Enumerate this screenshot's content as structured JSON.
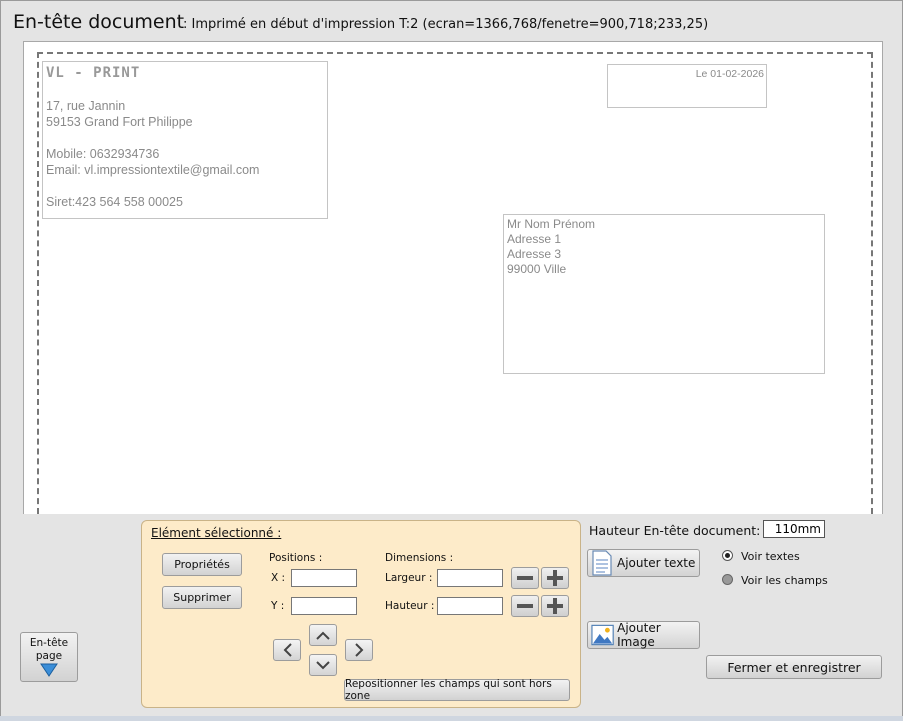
{
  "window": {
    "title": "En-tête document",
    "subtitle": ": Imprimé en début d'impression T:2 (ecran=1366,768/fenetre=900,718;233,25)"
  },
  "document": {
    "company": {
      "name": "VL - PRINT",
      "address1": "17, rue Jannin",
      "address2": "59153 Grand Fort Philippe",
      "mobile": "Mobile: 0632934736",
      "email": "Email: vl.impressiontextile@gmail.com",
      "siret": "Siret:423 564 558 00025"
    },
    "date": "Le 01-02-2026",
    "recipient": [
      "Mr Nom Prénom",
      "Adresse 1",
      "Adresse 3",
      "99000 Ville"
    ]
  },
  "panel": {
    "title": "Elément sélectionné :",
    "properties_label": "Propriétés",
    "delete_label": "Supprimer",
    "positions_label": "Positions :",
    "x_label": "X :",
    "y_label": "Y :",
    "dimensions_label": "Dimensions :",
    "width_label": "Largeur :",
    "height_label": "Hauteur :",
    "x_value": "",
    "y_value": "",
    "width_value": "",
    "height_value": "",
    "reposition_label": "Repositionner les champs qui sont hors zone"
  },
  "side": {
    "page_header_line1": "En-tête",
    "page_header_line2": "page",
    "header_height_label": "Hauteur En-tête document:",
    "header_height_value": "110mm",
    "add_text_label": "Ajouter texte",
    "add_image_label": "Ajouter Image",
    "show_texts_label": "Voir textes",
    "show_fields_label": "Voir les champs",
    "close_save_label": "Fermer et enregistrer"
  },
  "icons": {
    "page_header": "down-arrow-icon",
    "add_text": "document-icon",
    "add_image": "image-icon"
  }
}
